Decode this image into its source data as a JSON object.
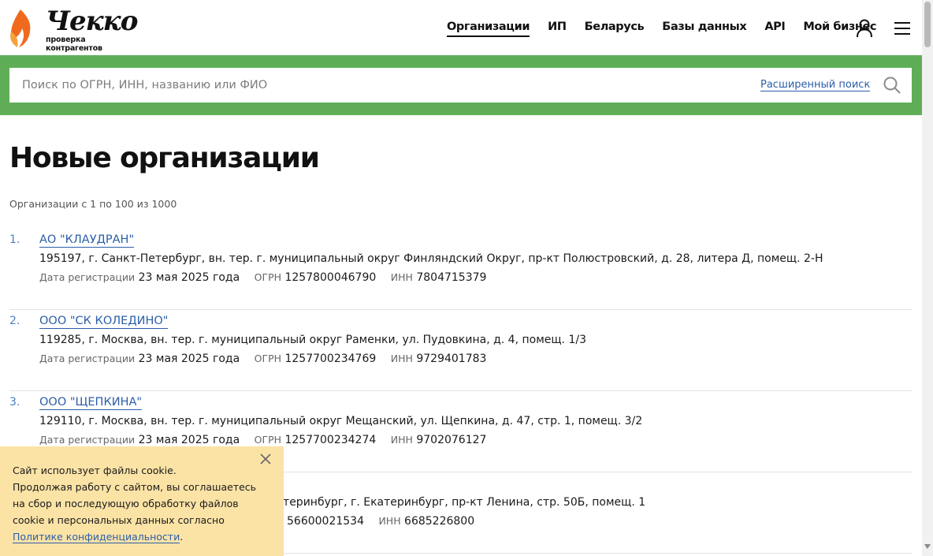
{
  "header": {
    "logo_word": "Чекко",
    "logo_sub": "проверка контрагентов",
    "nav": [
      {
        "label": "Организации",
        "active": true
      },
      {
        "label": "ИП"
      },
      {
        "label": "Беларусь"
      },
      {
        "label": "Базы данных"
      },
      {
        "label": "API"
      },
      {
        "label": "Мой бизнес"
      }
    ],
    "icons": [
      "user-icon",
      "menu-icon"
    ]
  },
  "search": {
    "placeholder": "Поиск по ОГРН, ИНН, названию или ФИО",
    "value": "",
    "advanced_label": "Расширенный поиск"
  },
  "main": {
    "title": "Новые организации",
    "count_text": "Организации с 1 по 100 из 1000",
    "meta_labels": {
      "reg": "Дата регистрации",
      "ogrn": "ОГРН",
      "inn": "ИНН"
    },
    "orgs": [
      {
        "num": "1.",
        "name": "АО \"КЛАУДРАН\"",
        "address": "195197, г. Санкт-Петербург, вн. тер. г. муниципальный округ Финляндский Округ, пр-кт Полюстровский, д. 28, литера Д, помещ. 2-Н",
        "reg_date": "23 мая 2025 года",
        "ogrn": "1257800046790",
        "inn": "7804715379"
      },
      {
        "num": "2.",
        "name": "ООО \"СК КОЛЕДИНО\"",
        "address": "119285, г. Москва, вн. тер. г. муниципальный округ Раменки, ул. Пудовкина, д. 4, помещ. 1/3",
        "reg_date": "23 мая 2025 года",
        "ogrn": "1257700234769",
        "inn": "9729401783"
      },
      {
        "num": "3.",
        "name": "ООО \"ЩЕПКИНА\"",
        "address": "129110, г. Москва, вн. тер. г. муниципальный округ Мещанский, ул. Щепкина, д. 47, стр. 1, помещ. 3/2",
        "reg_date": "23 мая 2025 года",
        "ogrn": "1257700234274",
        "inn": "9702076127"
      },
      {
        "num": "",
        "name": "",
        "address": "катеринбург, г. Екатеринбург, пр-кт Ленина, стр. 50Б, помещ. 1",
        "reg_date": "",
        "ogrn": "56600021534",
        "inn": "6685226800"
      }
    ]
  },
  "cookie": {
    "line1": "Сайт использует файлы cookie.",
    "line2": "Продолжая работу с сайтом, вы соглашаетесь на сбор и последующую обработку файлов cookie и персональных данных согласно",
    "link": "Политике конфиденциальности",
    "tail": "."
  },
  "colors": {
    "green_band": "#5fae57",
    "link_blue": "#2b5ea8",
    "cookie_bg": "#fbe3a6",
    "logo_orange": "#f06a1e"
  }
}
